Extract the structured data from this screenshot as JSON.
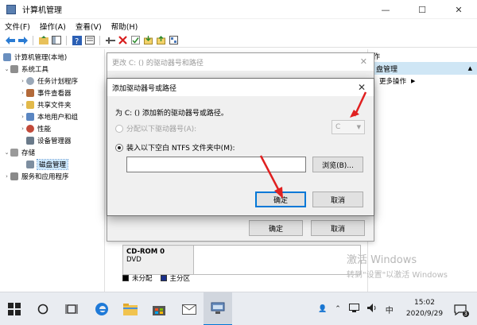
{
  "window": {
    "title": "计算机管理",
    "minimize": "—",
    "maximize": "☐",
    "close": "✕"
  },
  "menu": [
    "文件(F)",
    "操作(A)",
    "查看(V)",
    "帮助(H)"
  ],
  "tree": {
    "root": "计算机管理(本地)",
    "system_tools": "系统工具",
    "task_scheduler": "任务计划程序",
    "event_viewer": "事件查看器",
    "shared_folders": "共享文件夹",
    "local_users": "本地用户和组",
    "performance": "性能",
    "device_manager": "设备管理器",
    "storage": "存储",
    "disk_management": "磁盘管理",
    "services_apps": "服务和应用程序"
  },
  "actions": {
    "header": "作",
    "section": "盘管理",
    "more": "更多操作"
  },
  "disk_area": {
    "cd_name": "CD-ROM 0",
    "cd_type": "DVD",
    "legend_unallocated": "未分配",
    "legend_primary": "主分区"
  },
  "watermark": {
    "line1": "激活 Windows",
    "line2": "转到\"设置\"以激活 Windows"
  },
  "outer_dialog": {
    "title": "更改 C: () 的驱动器号和路径",
    "close": "✕",
    "ok": "确定",
    "cancel": "取消"
  },
  "inner_dialog": {
    "title": "添加驱动器号或路径",
    "close": "✕",
    "prompt": "为 C: () 添加新的驱动器号或路径。",
    "option_letter": "分配以下驱动器号(A):",
    "drive_letter": "C",
    "option_folder": "装入以下空白 NTFS 文件夹中(M):",
    "path_value": "",
    "browse": "浏览(B)...",
    "ok": "确定",
    "cancel": "取消"
  },
  "taskbar": {
    "time": "15:02",
    "date": "2020/9/29",
    "ime": "中",
    "notifications": "3"
  },
  "colors": {
    "accent": "#0078d7",
    "arrow": "#e02020",
    "selection": "#cce8ff"
  }
}
